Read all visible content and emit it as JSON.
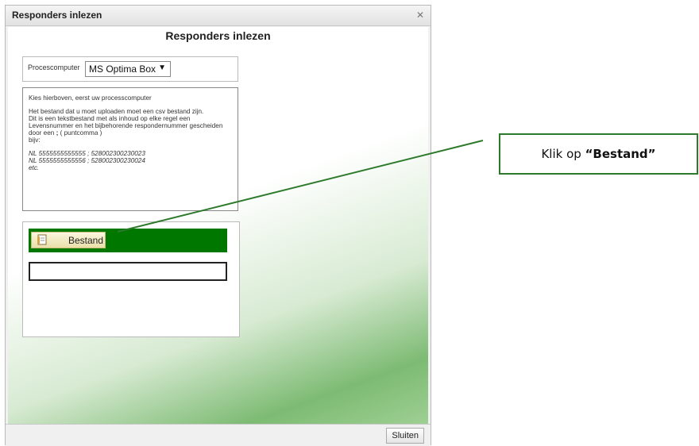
{
  "dialog": {
    "title": "Responders inlezen",
    "close_icon": "close-icon",
    "heading": "Responders inlezen",
    "processcomputer": {
      "label": "Procescomputer",
      "selected": "MS Optima Box",
      "arrow": "▼"
    },
    "info": {
      "line1": "Kies hierboven, eerst uw processcomputer",
      "para2_a": "Het bestand dat u moet uploaden moet een csv bestand zijn.",
      "para2_b": "Dit is een tekstbestand met als inhoud op elke regel een Levensnummer en het bijbehorende respondernummer gescheiden door een ",
      "para2_semicolon": ";",
      "para2_c": " ( puntcomma )",
      "para2_d": "bijv:",
      "example1": "NL 5555555555555 ; 528002300230023",
      "example2": "NL 5555555555556 ; 528002300230024",
      "example3": "etc."
    },
    "upload": {
      "button_label": "Bestand",
      "button_icon": "file-icon",
      "file_value": ""
    },
    "footer": {
      "close_label": "Sluiten"
    }
  },
  "annotation": {
    "text_prefix": "Klik op ",
    "text_bold": "“Bestand”"
  },
  "colors": {
    "upload_bar": "#007800",
    "callout_border": "#2d7a2d",
    "connector": "#2d7a2d"
  }
}
